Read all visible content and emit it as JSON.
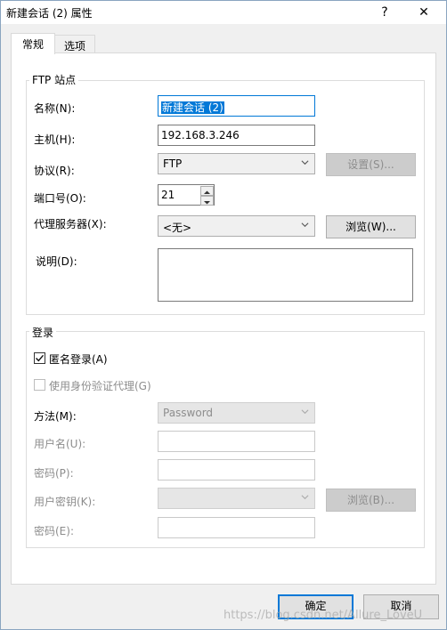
{
  "window": {
    "title": "新建会话 (2) 属性",
    "help_glyph": "?",
    "close_glyph": "✕"
  },
  "tabs": [
    {
      "label": "常规",
      "active": true
    },
    {
      "label": "选项",
      "active": false
    }
  ],
  "ftp_site": {
    "group_title": "FTP 站点",
    "name_label": "名称(N):",
    "name_value": "新建会话 (2)",
    "host_label": "主机(H):",
    "host_value": "192.168.3.246",
    "protocol_label": "协议(R):",
    "protocol_value": "FTP",
    "settings_button": "设置(S)...",
    "port_label": "端口号(O):",
    "port_value": "21",
    "proxy_label": "代理服务器(X):",
    "proxy_value": "<无>",
    "browse_button": "浏览(W)...",
    "desc_label": "说明(D):",
    "desc_value": ""
  },
  "login": {
    "group_title": "登录",
    "anonymous_label": "匿名登录(A)",
    "anonymous_checked": true,
    "auth_agent_label": "使用身份验证代理(G)",
    "auth_agent_checked": false,
    "method_label": "方法(M):",
    "method_value": "Password",
    "username_label": "用户名(U):",
    "password_label": "密码(P):",
    "user_key_label": "用户密钥(K):",
    "browse_key_button": "浏览(B)...",
    "passphrase_label": "密码(E):"
  },
  "footer": {
    "ok_button": "确定",
    "cancel_button": "取消"
  },
  "watermark": "https://blog.csdn.net/Allure_LoveU"
}
